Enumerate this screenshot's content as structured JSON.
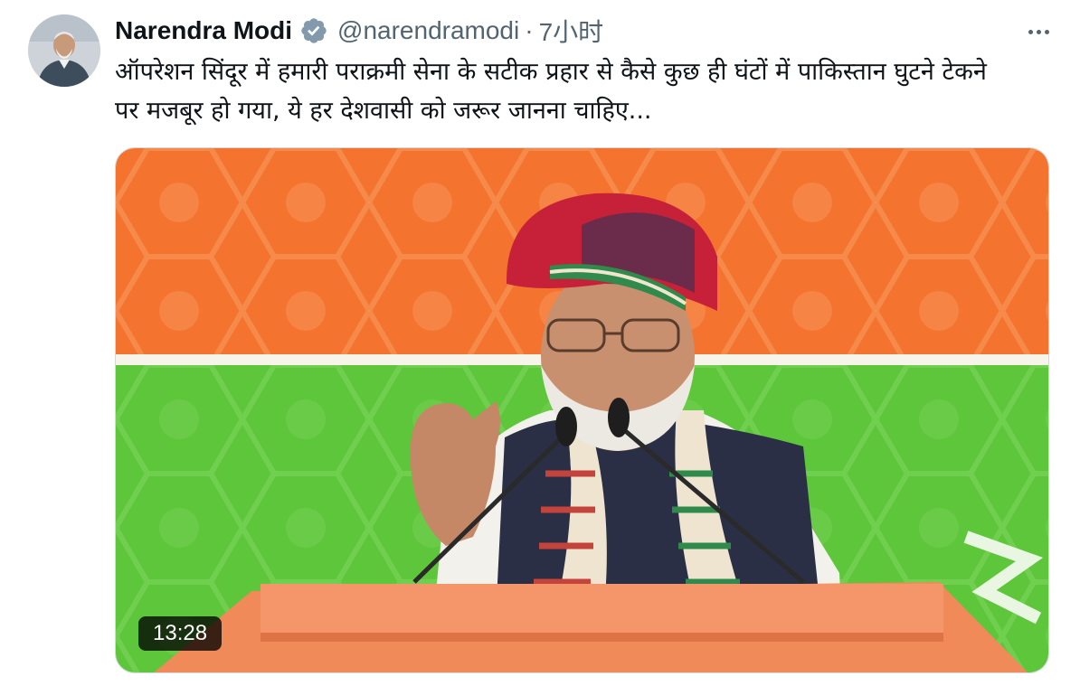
{
  "tweet": {
    "author_name": "Narendra Modi",
    "handle": "@narendramodi",
    "separator": "·",
    "time": "7小时",
    "text_lines": [
      "ऑपरेशन सिंदूर में हमारी पराक्रमी सेना के सटीक प्रहार से कैसे कुछ ही घंटों में पाकिस्तान घुटने टेकने",
      "पर मजबूर हो गया, ये हर देशवासी को जरूर जानना चाहिए..."
    ],
    "video": {
      "duration": "13:28"
    }
  },
  "icons": {
    "verified": "verified-badge-icon",
    "more": "more-horizontal-icon",
    "avatar": "user-avatar"
  },
  "colors": {
    "text_primary": "#0f1419",
    "text_secondary": "#536471",
    "verified_badge": "#829aab",
    "video_top": "#f4742f",
    "video_bottom": "#5ec63b"
  }
}
